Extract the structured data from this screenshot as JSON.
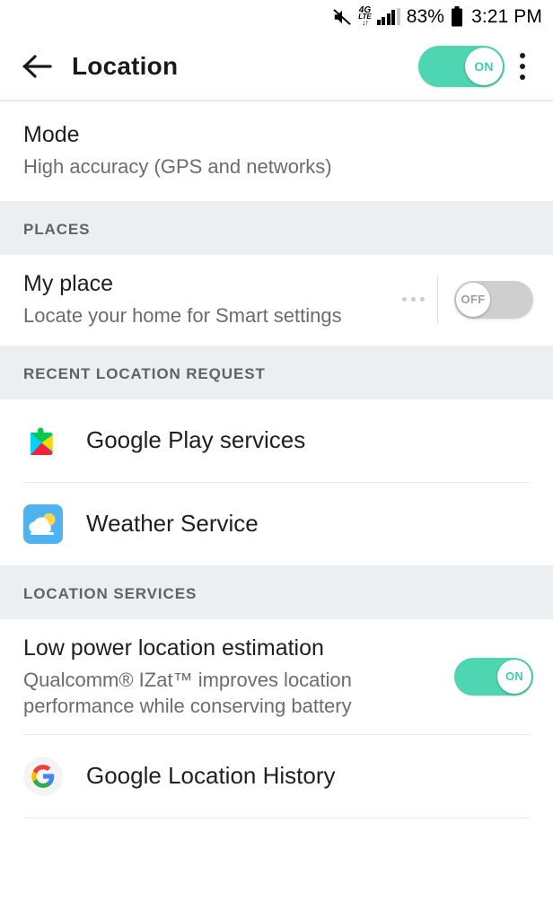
{
  "statusbar": {
    "mute_icon": "mute-speaker-icon",
    "network_top": "4G",
    "network_bottom": "LTE",
    "data_arrows": "↓↑",
    "signal_icon": "signal-bars-icon",
    "battery_percent": "83%",
    "battery_icon": "battery-full-icon",
    "time": "3:21 PM"
  },
  "appbar": {
    "back_icon": "back-arrow-icon",
    "title": "Location",
    "master_toggle": {
      "label": "ON",
      "state": "on"
    },
    "overflow_icon": "overflow-menu-icon"
  },
  "mode": {
    "title": "Mode",
    "subtitle": "High accuracy (GPS and networks)"
  },
  "places": {
    "header": "PLACES",
    "my_place": {
      "title": "My place",
      "subtitle": "Locate your home for Smart settings",
      "more_icon": "more-options-icon",
      "toggle": {
        "label": "OFF",
        "state": "off"
      }
    }
  },
  "recent_location_request": {
    "header": "RECENT LOCATION REQUEST",
    "items": [
      {
        "label": "Google Play services",
        "icon": "google-play-services-icon"
      },
      {
        "label": "Weather Service",
        "icon": "weather-service-icon"
      }
    ]
  },
  "location_services": {
    "header": "LOCATION SERVICES",
    "low_power": {
      "title": "Low power location estimation",
      "subtitle": "Qualcomm® IZat™ improves location performance while conserving battery",
      "toggle": {
        "label": "ON",
        "state": "on"
      }
    },
    "google_location_history": {
      "label": "Google Location History",
      "icon": "google-logo-icon"
    }
  },
  "colors": {
    "accent_on": "#4ed6b2",
    "toggle_off": "#cfcfcf",
    "section_bg": "#eceff1",
    "title_text": "#1f1f1f",
    "subtitle_text": "#6c6c6c"
  }
}
